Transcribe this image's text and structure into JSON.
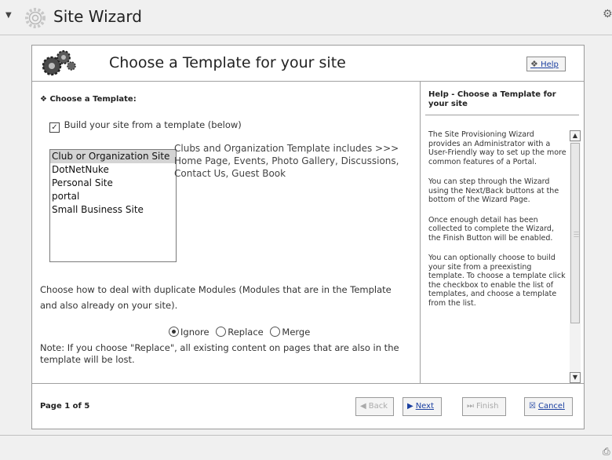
{
  "window": {
    "title": "Site Wizard"
  },
  "wizard": {
    "header_title": "Choose a Template for your site",
    "help_button_label": "Help"
  },
  "main": {
    "section_label": "Choose a Template:",
    "build_checkbox": {
      "label": "Build your site from a template (below)",
      "checked": true
    },
    "templates": [
      "Club or Organization Site",
      "DotNetNuke",
      "Personal Site",
      "portal",
      "Small Business Site"
    ],
    "selected_template": "Club or Organization Site",
    "template_description": "Clubs and Organization Template includes >>> Home Page, Events, Photo Gallery, Discussions, Contact Us, Guest Book",
    "duplicate_text": "Choose how to deal with duplicate Modules (Modules that are in the Template and also already on your site).",
    "duplicate_options": [
      "Ignore",
      "Replace",
      "Merge"
    ],
    "selected_duplicate_option": "Ignore",
    "note": "Note: If you choose \"Replace\", all existing content on pages that are also in the template will be lost."
  },
  "help_panel": {
    "title": "Help - Choose a Template for your site",
    "paragraphs": [
      "The Site Provisioning Wizard provides an Administrator with a User-Friendly way to set up the more common features of a Portal.",
      "You can step through the Wizard using the Next/Back buttons at the bottom of the Wizard Page.",
      "Once enough detail has been collected to complete the Wizard, the Finish Button will be enabled.",
      "You can optionally choose to build your site from a preexisting template. To choose a template click the checkbox to enable the list of templates, and choose a template from the list."
    ]
  },
  "footer": {
    "page_indicator": "Page 1 of 5",
    "back_label": "Back",
    "next_label": "Next",
    "finish_label": "Finish",
    "cancel_label": "Cancel"
  }
}
